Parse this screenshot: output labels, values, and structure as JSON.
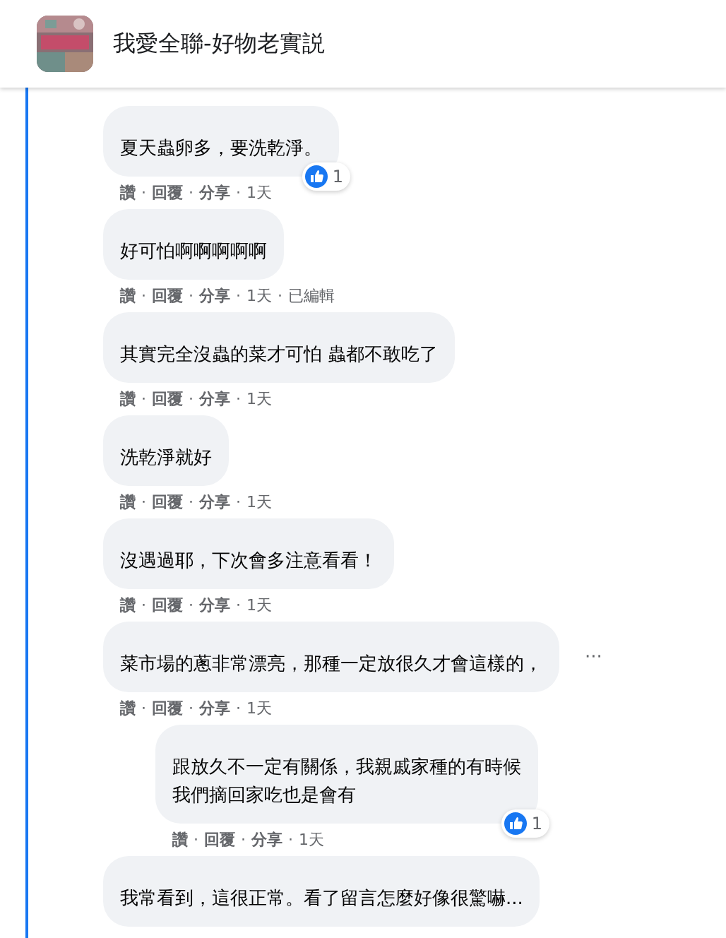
{
  "header": {
    "title": "我愛全聯-好物老實説"
  },
  "separator": "·",
  "comments": [
    {
      "reply": false,
      "text": "夏天蟲卵多，要洗乾淨。",
      "actions": [
        "讚",
        "回覆",
        "分享",
        "1天"
      ],
      "reactions": "1",
      "menu": false
    },
    {
      "reply": false,
      "text": "好可怕啊啊啊啊啊",
      "actions": [
        "讚",
        "回覆",
        "分享",
        "1天",
        "已編輯"
      ],
      "menu": false
    },
    {
      "reply": false,
      "text": "其實完全沒蟲的菜才可怕 蟲都不敢吃了",
      "actions": [
        "讚",
        "回覆",
        "分享",
        "1天"
      ],
      "menu": false
    },
    {
      "reply": false,
      "text": "洗乾淨就好",
      "actions": [
        "讚",
        "回覆",
        "分享",
        "1天"
      ],
      "menu": false
    },
    {
      "reply": false,
      "text": "沒遇過耶，下次會多注意看看！",
      "actions": [
        "讚",
        "回覆",
        "分享",
        "1天"
      ],
      "menu": false
    },
    {
      "reply": false,
      "text": "菜市場的蔥非常漂亮，那種一定放很久才會這樣的，",
      "actions": [
        "讚",
        "回覆",
        "分享",
        "1天"
      ],
      "menu": true,
      "menu_icon": "···"
    },
    {
      "reply": true,
      "text": "跟放久不一定有關係，我親戚家種的有時候我們摘回家吃也是會有",
      "actions": [
        "讚",
        "回覆",
        "分享",
        "1天"
      ],
      "reactions": "1",
      "menu": false
    },
    {
      "reply": false,
      "text": "我常看到，這很正常。看了留言怎麼好像很驚嚇...",
      "menu": false
    }
  ]
}
